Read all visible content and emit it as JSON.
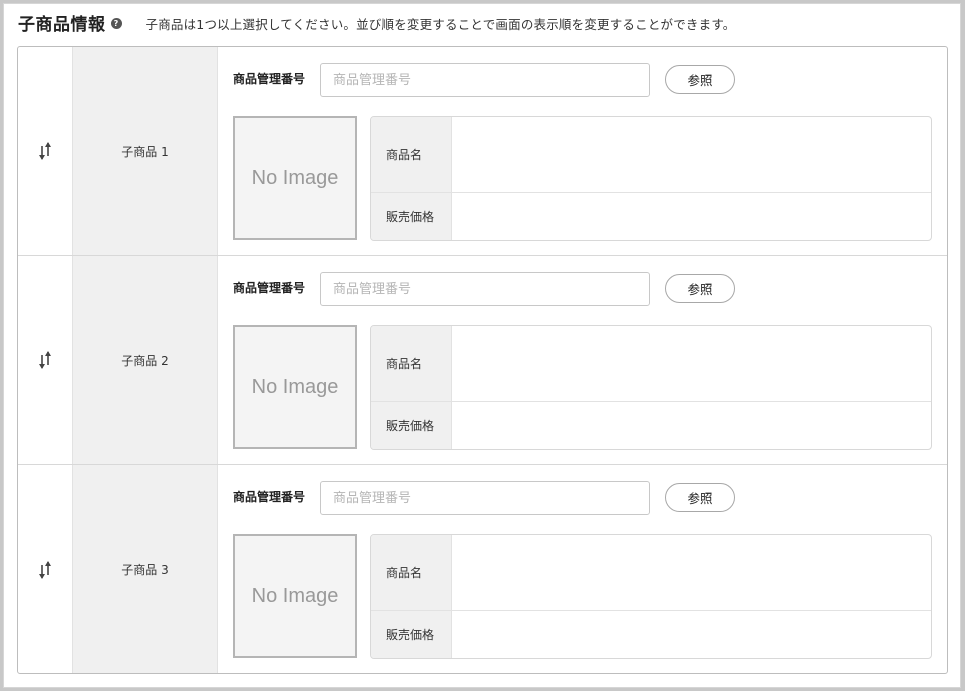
{
  "header": {
    "title": "子商品情報",
    "help_icon": "?",
    "description": "子商品は1つ以上選択してください。並び順を変更することで画面の表示順を変更することができます。"
  },
  "rows": [
    {
      "label": "子商品 1",
      "code_label": "商品管理番号",
      "code_placeholder": "商品管理番号",
      "code_value": "",
      "ref_button": "参照",
      "image_text": "No Image",
      "name_label": "商品名",
      "name_value": "",
      "price_label": "販売価格",
      "price_value": ""
    },
    {
      "label": "子商品 2",
      "code_label": "商品管理番号",
      "code_placeholder": "商品管理番号",
      "code_value": "",
      "ref_button": "参照",
      "image_text": "No Image",
      "name_label": "商品名",
      "name_value": "",
      "price_label": "販売価格",
      "price_value": ""
    },
    {
      "label": "子商品 3",
      "code_label": "商品管理番号",
      "code_placeholder": "商品管理番号",
      "code_value": "",
      "ref_button": "参照",
      "image_text": "No Image",
      "name_label": "商品名",
      "name_value": "",
      "price_label": "販売価格",
      "price_value": ""
    }
  ],
  "icons": {
    "sort": "sort-arrows-icon",
    "help": "question-circle-icon"
  }
}
